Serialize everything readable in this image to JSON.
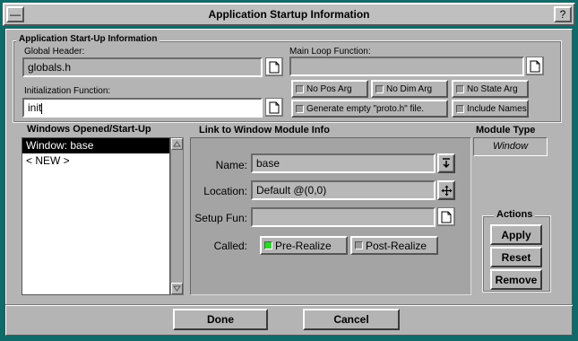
{
  "window": {
    "title": "Application Startup Information",
    "menu_glyph": "—",
    "help_glyph": "?"
  },
  "startup_group": {
    "label": "Application Start-Up Information",
    "global_header": {
      "label": "Global Header:",
      "value": "globals.h"
    },
    "init_function": {
      "label": "Initialization Function:",
      "value": "init"
    },
    "main_loop": {
      "label": "Main Loop Function:",
      "value": ""
    },
    "options": [
      {
        "label": "No Pos Arg",
        "checked": false
      },
      {
        "label": "No Dim Arg",
        "checked": false
      },
      {
        "label": "No State Arg",
        "checked": false
      },
      {
        "label": "Generate empty \"proto.h\" file.",
        "checked": false
      },
      {
        "label": "Include Names",
        "checked": false
      }
    ]
  },
  "windows_list": {
    "heading": "Windows Opened/Start-Up",
    "items": [
      "Window: base",
      "< NEW >"
    ],
    "selected_index": 0
  },
  "link_panel": {
    "heading": "Link to Window Module Info",
    "name": {
      "label": "Name:",
      "value": "base"
    },
    "location": {
      "label": "Location:",
      "value": "Default @(0,0)"
    },
    "setup_fun": {
      "label": "Setup Fun:",
      "value": ""
    },
    "called": {
      "label": "Called:",
      "pre_realize": {
        "label": "Pre-Realize",
        "checked": true
      },
      "post_realize": {
        "label": "Post-Realize",
        "checked": false
      }
    }
  },
  "module_type": {
    "heading": "Module Type",
    "value": "Window"
  },
  "actions": {
    "label": "Actions",
    "apply": "Apply",
    "reset": "Reset",
    "remove": "Remove"
  },
  "footer": {
    "done": "Done",
    "cancel": "Cancel"
  },
  "colors": {
    "desktop": "#0f6a6a",
    "panel": "#b4b4b4",
    "checked_indicator": "#22dd22"
  },
  "icons": {
    "file_browse": "document-icon",
    "dropdown": "down-arrow-bar-icon",
    "move": "four-way-arrow-icon"
  }
}
